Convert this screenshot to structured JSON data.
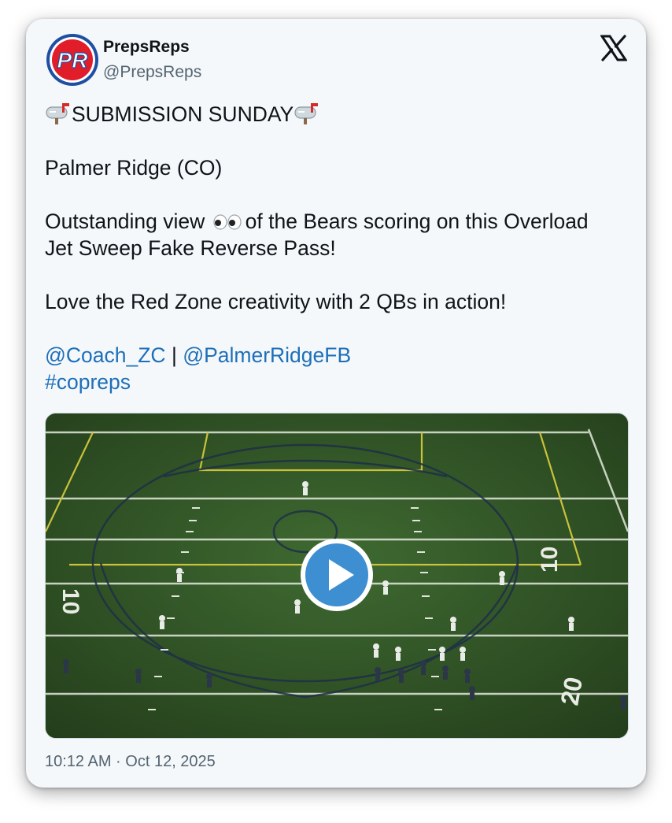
{
  "author": {
    "display_name": "PrepsReps",
    "handle": "@PrepsReps",
    "avatar_letters": "PR",
    "avatar_colors": {
      "ring": "#1f4fa3",
      "fill": "#e11d2a",
      "letters": "#ffffff"
    }
  },
  "platform_icon": "x-logo-icon",
  "tweet": {
    "heading": "SUBMISSION SUNDAY",
    "heading_icon": "mailbox-icon",
    "school": "Palmer Ridge (CO)",
    "line1_before_eyes": "Outstanding view",
    "eyes_icon": "eyes-icon",
    "line1_after_eyes": "of the Bears scoring on this Overload",
    "line2": "Jet Sweep Fake Reverse Pass!",
    "line3": "Love the Red Zone creativity with 2 QBs in action!",
    "mention1": "@Coach_ZC",
    "separator": " | ",
    "mention2": "@PalmerRidgeFB",
    "hashtag": "#copreps",
    "link_color": "#1d6fba"
  },
  "media": {
    "type": "video",
    "play_icon": "play-icon",
    "yard_marker_left": "10",
    "yard_marker_right": "10",
    "yard_marker_bottom": "20"
  },
  "timestamp": "10:12 AM · Oct 12, 2025"
}
